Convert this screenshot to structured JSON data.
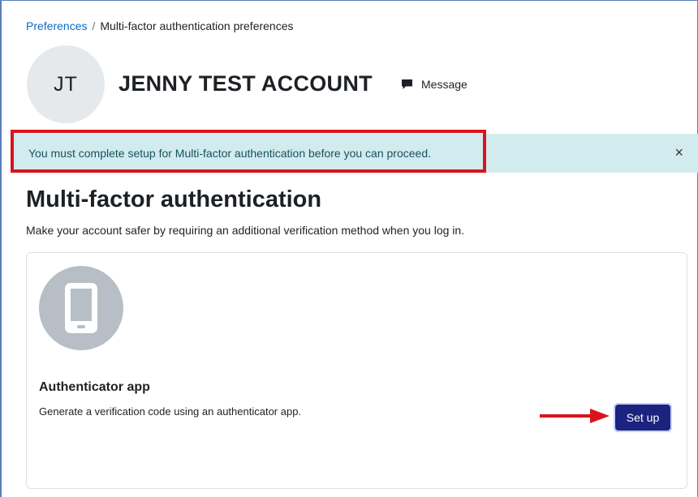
{
  "breadcrumb": {
    "parent": "Preferences",
    "separator": "/",
    "current": "Multi-factor authentication preferences"
  },
  "profile": {
    "initials": "JT",
    "fullname": "JENNY TEST ACCOUNT",
    "message_label": "Message"
  },
  "alert": {
    "text": "You must complete setup for Multi-factor authentication before you can proceed.",
    "close_glyph": "×"
  },
  "page": {
    "title": "Multi-factor authentication",
    "description": "Make your account safer by requiring an additional verification method when you log in."
  },
  "factor": {
    "icon": "mobile-phone-icon",
    "title": "Authenticator app",
    "description": "Generate a verification code using an authenticator app.",
    "button_label": "Set up"
  },
  "colors": {
    "link": "#0f6cbf",
    "alert_bg": "#d2ebef",
    "highlight": "#d9141c",
    "button_bg": "#1a237e",
    "arrow": "#d9141c"
  }
}
